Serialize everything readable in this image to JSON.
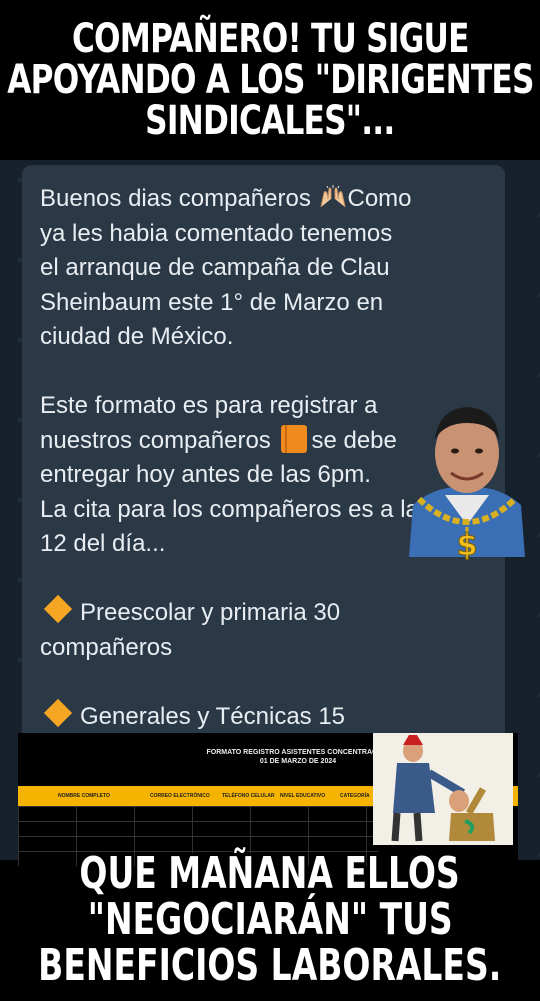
{
  "top_caption": {
    "line1": "COMPAÑERO! TU SIGUE",
    "line2": "APOYANDO A LOS \"DIRIGENTES",
    "line3": "SINDICALES\"..."
  },
  "message": {
    "lines": [
      "Buenos dias compañeros ",
      "Como",
      "ya les habia comentado tenemos",
      "el arranque de campaña de Clau",
      "Sheinbaum este 1° de Marzo en",
      "ciudad de México.",
      "Este formato es para registrar a",
      "nuestros compañeros ",
      "se debe",
      "entregar hoy antes de las 6pm.",
      "La cita para los compañeros es a las",
      "12 del día...",
      "Preescolar y primaria 30",
      "compañeros",
      "Generales y Técnicas 15"
    ],
    "icons": {
      "hands": "raising-hands-icon",
      "book": "orange-book-icon",
      "bullet": "orange-diamond-icon"
    }
  },
  "document": {
    "title_line1": "FORMATO REGISTRO ASISTENTES CONCENTRACION",
    "title_line2": "01 DE MARZO DE 2024",
    "columns": [
      "NOMBRE COMPLETO",
      "CORREO ELECTRÓNICO",
      "TELÉFONO CELULAR",
      "NIVEL EDUCATIVO",
      "CATEGORÍA"
    ],
    "header_color": "#f5b400"
  },
  "bottom_caption": {
    "line1": "QUE MAÑANA ELLOS",
    "line2": "\"NEGOCIARÁN\" TUS",
    "line3": "BENEFICIOS LABORALES."
  },
  "colors": {
    "chat_bg": "#17212b",
    "bubble_bg": "#2b3947",
    "text": "#e8edf1"
  }
}
